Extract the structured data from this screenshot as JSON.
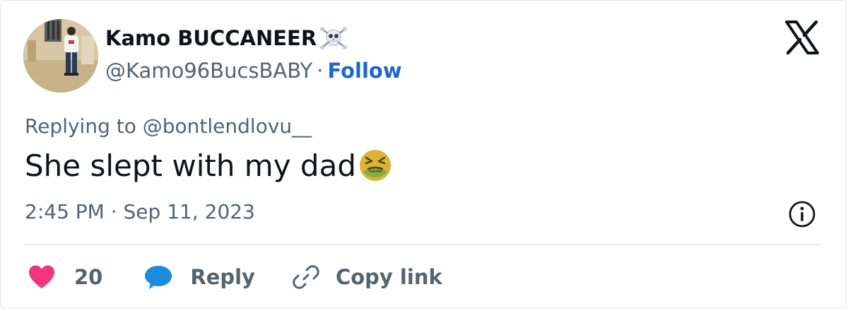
{
  "author": {
    "display_name": "Kamo BUCCANEER",
    "handle": "@Kamo96BucsBABY",
    "separator": "·",
    "follow_label": "Follow",
    "badge_icon": "skull-crossbones-icon"
  },
  "tweet": {
    "replying_to": "Replying to @bontlendlovu__",
    "text": "She slept with my dad",
    "emoji_icon": "nauseated-face-icon",
    "timestamp": "2:45 PM · Sep 11, 2023"
  },
  "actions": {
    "like_count": "20",
    "reply_label": "Reply",
    "copy_link_label": "Copy link"
  },
  "colors": {
    "follow": "#1d67c9",
    "like": "#f0357f",
    "reply_bubble": "#1d8be0",
    "secondary_text": "#536471"
  }
}
